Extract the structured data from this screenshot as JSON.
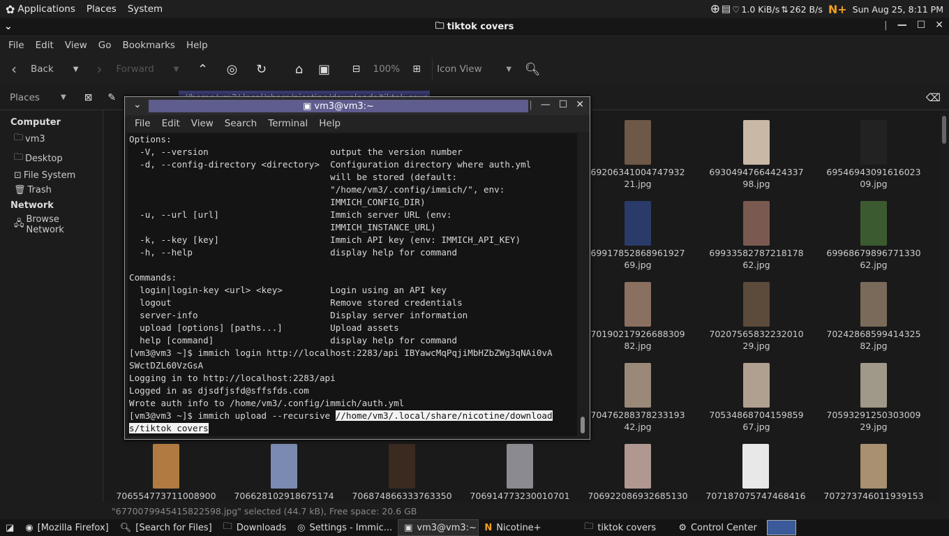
{
  "topbar": {
    "applications": "Applications",
    "places": "Places",
    "system": "System",
    "net_down": "1.0 KiB/s",
    "net_up": "262 B/s",
    "clock": "Sun Aug 25,  8:11 PM"
  },
  "fm": {
    "title": "tiktok covers",
    "menu": [
      "File",
      "Edit",
      "View",
      "Go",
      "Bookmarks",
      "Help"
    ],
    "toolbar": {
      "back": "Back",
      "forward": "Forward",
      "zoom": "100%",
      "view_mode": "Icon View"
    },
    "places_label": "Places",
    "path_partial": "//home/vm3/.local/share/nicotine/downloads/tiktok covers",
    "sidebar": {
      "computer": "Computer",
      "items": [
        "vm3",
        "Desktop",
        "File System",
        "Trash"
      ],
      "network": "Network",
      "network_items": [
        "Browse Network"
      ]
    },
    "files": [
      {
        "l1": "69206341004747932",
        "l2": "21.jpg",
        "color": "#6e5848"
      },
      {
        "l1": "69304947664424337",
        "l2": "98.jpg",
        "color": "#c9b8a6"
      },
      {
        "l1": "69546943091616023",
        "l2": "09.jpg",
        "color": "#222"
      },
      {
        "l1": "69917852868961927",
        "l2": "69.jpg",
        "color": "#2a3b6a"
      },
      {
        "l1": "69933582787218178",
        "l2": "62.jpg",
        "color": "#7a5a50"
      },
      {
        "l1": "69968679896771330",
        "l2": "62.jpg",
        "color": "#3c5a30"
      },
      {
        "l1": "70190217926688309",
        "l2": "82.jpg",
        "color": "#8a7060"
      },
      {
        "l1": "70207565832232010",
        "l2": "29.jpg",
        "color": "#5c4a3a"
      },
      {
        "l1": "70242868599414325",
        "l2": "82.jpg",
        "color": "#7a6a5a"
      },
      {
        "l1": "70476288378233193",
        "l2": "42.jpg",
        "color": "#9a8878"
      },
      {
        "l1": "70534868704159859",
        "l2": "67.jpg",
        "color": "#b0a090"
      },
      {
        "l1": "70593291250303009",
        "l2": "29.jpg",
        "color": "#a09888"
      },
      {
        "l1": "706554773711008900",
        "l2": "",
        "color": "#b07a40"
      },
      {
        "l1": "706628102918675174",
        "l2": "",
        "color": "#7a8ab0"
      },
      {
        "l1": "706874866333763350",
        "l2": "",
        "color": "#3a2a20"
      },
      {
        "l1": "706914773230010701",
        "l2": "",
        "color": "#8a8a90"
      },
      {
        "l1": "706922086932685130",
        "l2": "",
        "color": "#b09890"
      },
      {
        "l1": "707187075747468416",
        "l2": "",
        "color": "#e8e8e8"
      },
      {
        "l1": "707273746011939153",
        "l2": "",
        "color": "#a89070"
      }
    ],
    "status": "\"6770079945415822598.jpg\" selected (44.7 kB), Free space: 20.6 GB"
  },
  "term": {
    "title": "vm3@vm3:~",
    "menu": [
      "File",
      "Edit",
      "View",
      "Search",
      "Terminal",
      "Help"
    ],
    "lines": [
      "Options:",
      "  -V, --version                       output the version number",
      "  -d, --config-directory <directory>  Configuration directory where auth.yml",
      "                                      will be stored (default:",
      "                                      \"/home/vm3/.config/immich/\", env:",
      "                                      IMMICH_CONFIG_DIR)",
      "  -u, --url [url]                     Immich server URL (env:",
      "                                      IMMICH_INSTANCE_URL)",
      "  -k, --key [key]                     Immich API key (env: IMMICH_API_KEY)",
      "  -h, --help                          display help for command",
      "",
      "Commands:",
      "  login|login-key <url> <key>         Login using an API key",
      "  logout                              Remove stored credentials",
      "  server-info                         Display server information",
      "  upload [options] [paths...]         Upload assets",
      "  help [command]                      display help for command",
      "[vm3@vm3 ~]$ immich login http://localhost:2283/api IBYawcMqPqjiMbHZbZWg3qNAi0vA",
      "SWctDZL60VzGsA",
      "Logging in to http://localhost:2283/api",
      "Logged in as djsdfjsfd@sffsfds.com",
      "Wrote auth info to /home/vm3/.config/immich/auth.yml"
    ],
    "prompt": "[vm3@vm3 ~]$ immich upload --recursive ",
    "sel1": "//home/vm3/.local/share/nicotine/download",
    "sel2": "s/tiktok covers"
  },
  "taskbar": [
    "[Mozilla Firefox]",
    "[Search for Files]",
    "Downloads",
    "Settings - Immic...",
    "vm3@vm3:~",
    "Nicotine+",
    "tiktok covers",
    "Control Center"
  ]
}
